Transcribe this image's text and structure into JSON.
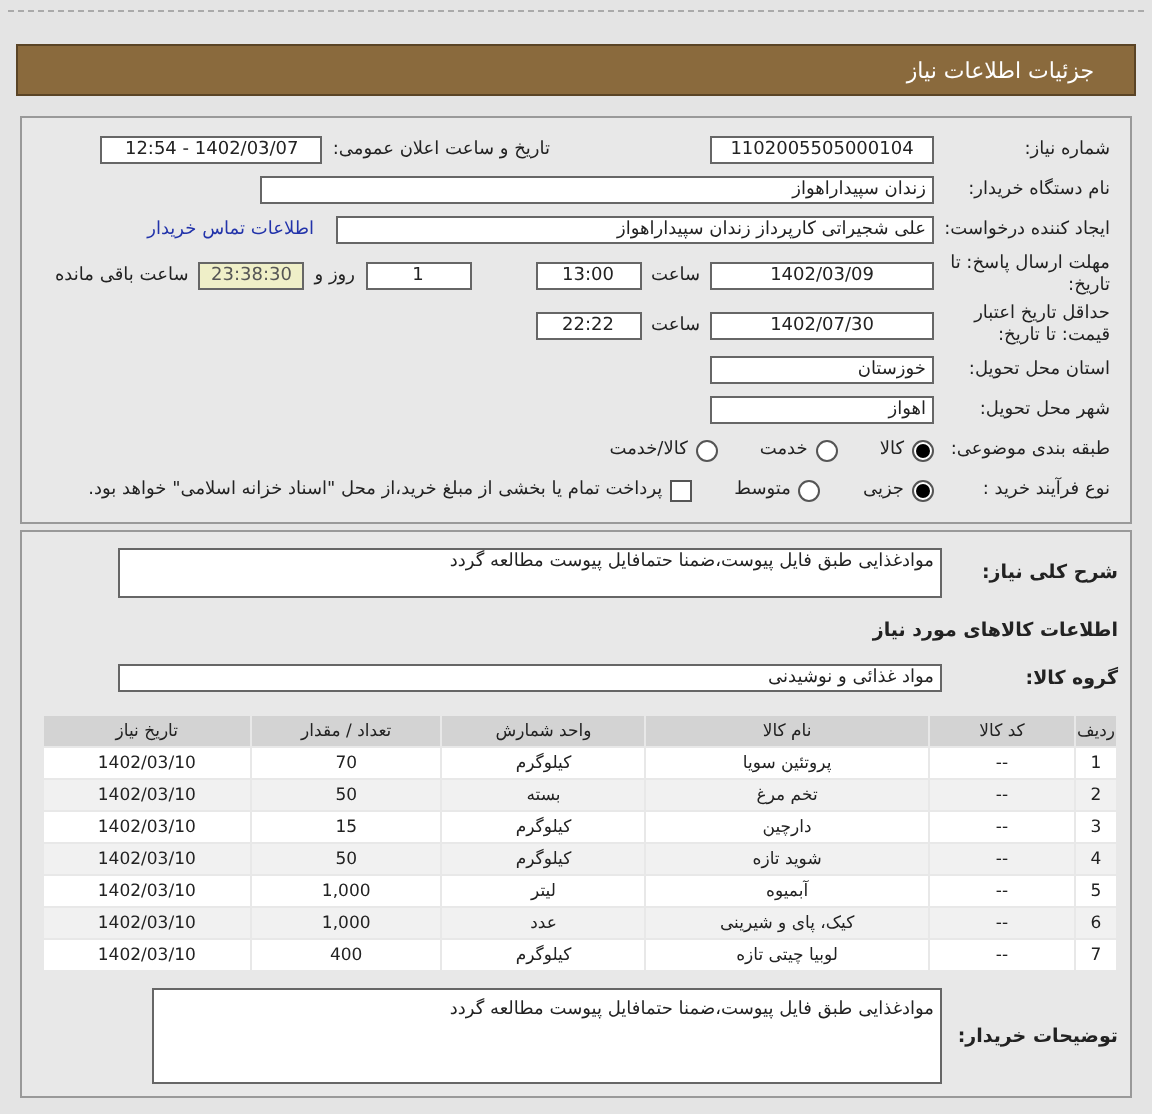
{
  "header": {
    "title": "جزئیات اطلاعات نیاز"
  },
  "need_number": {
    "label": "شماره نیاز:",
    "value": "1102005505000104"
  },
  "announce": {
    "label": "تاریخ و ساعت اعلان عمومی:",
    "value": "1402/03/07 - 12:54"
  },
  "buyer_org": {
    "label": "نام دستگاه خریدار:",
    "value": "زندان سپیداراهواز"
  },
  "requester": {
    "label": "ایجاد کننده درخواست:",
    "value": "علی شجیراتی کارپرداز زندان سپیداراهواز",
    "link": "اطلاعات تماس خریدار"
  },
  "deadline": {
    "label": "مهلت ارسال پاسخ: تا تاریخ:",
    "date": "1402/03/09",
    "time_label": "ساعت",
    "time": "13:00",
    "days": "1",
    "days_label": "روز و",
    "remaining": "23:38:30",
    "remaining_label": "ساعت باقی مانده"
  },
  "validity": {
    "label": "حداقل تاریخ اعتبار قیمت: تا تاریخ:",
    "date": "1402/07/30",
    "time_label": "ساعت",
    "time": "22:22"
  },
  "province": {
    "label": "استان محل تحویل:",
    "value": "خوزستان"
  },
  "city": {
    "label": "شهر محل تحویل:",
    "value": "اهواز"
  },
  "category": {
    "label": "طبقه بندی موضوعی:",
    "options": [
      {
        "label": "کالا",
        "selected": true
      },
      {
        "label": "خدمت",
        "selected": false
      },
      {
        "label": "کالا/خدمت",
        "selected": false
      }
    ]
  },
  "purchase_type": {
    "label": "نوع فرآیند خرید :",
    "options": [
      {
        "label": "جزیی",
        "selected": true
      },
      {
        "label": "متوسط",
        "selected": false
      }
    ],
    "payment_note": {
      "label": "پرداخت تمام یا بخشی از مبلغ خرید،از محل \"اسناد خزانه اسلامی\" خواهد بود.",
      "checked": false
    }
  },
  "description": {
    "label": "شرح کلی نیاز:",
    "value": "موادغذایی طبق فایل پیوست،ضمنا حتمافایل پیوست مطالعه گردد"
  },
  "goods_heading": "اطلاعات کالاهای مورد نیاز",
  "goods_group": {
    "label": "گروه کالا:",
    "value": "مواد غذائی و نوشیدنی"
  },
  "table": {
    "columns": [
      "ردیف",
      "کد کالا",
      "نام کالا",
      "واحد شمارش",
      "تعداد / مقدار",
      "تاریخ نیاز"
    ],
    "rows": [
      [
        "1",
        "--",
        "پروتئین سویا",
        "کیلوگرم",
        "70",
        "1402/03/10"
      ],
      [
        "2",
        "--",
        "تخم مرغ",
        "بسته",
        "50",
        "1402/03/10"
      ],
      [
        "3",
        "--",
        "دارچین",
        "کیلوگرم",
        "15",
        "1402/03/10"
      ],
      [
        "4",
        "--",
        "شوید تازه",
        "کیلوگرم",
        "50",
        "1402/03/10"
      ],
      [
        "5",
        "--",
        "آبمیوه",
        "لیتر",
        "1,000",
        "1402/03/10"
      ],
      [
        "6",
        "--",
        "کیک، پای و شیرینی",
        "عدد",
        "1,000",
        "1402/03/10"
      ],
      [
        "7",
        "--",
        "لوبیا چیتی تازه",
        "کیلوگرم",
        "400",
        "1402/03/10"
      ]
    ]
  },
  "buyer_notes": {
    "label": "توضیحات خریدار:",
    "value": "موادغذایی طبق فایل پیوست،ضمنا حتمافایل پیوست مطالعه گردد"
  }
}
